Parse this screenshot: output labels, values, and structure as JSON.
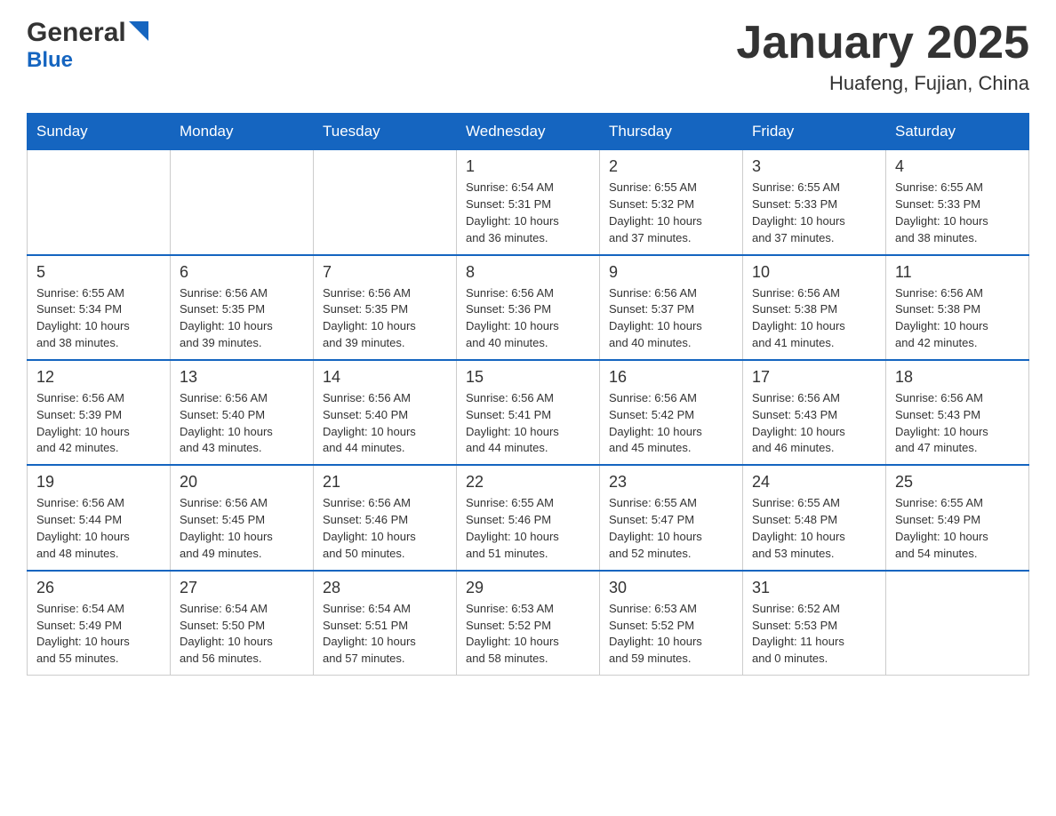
{
  "header": {
    "title": "January 2025",
    "subtitle": "Huafeng, Fujian, China",
    "logo_general": "General",
    "logo_blue": "Blue"
  },
  "calendar": {
    "days_of_week": [
      "Sunday",
      "Monday",
      "Tuesday",
      "Wednesday",
      "Thursday",
      "Friday",
      "Saturday"
    ],
    "weeks": [
      [
        {
          "day": "",
          "info": ""
        },
        {
          "day": "",
          "info": ""
        },
        {
          "day": "",
          "info": ""
        },
        {
          "day": "1",
          "info": "Sunrise: 6:54 AM\nSunset: 5:31 PM\nDaylight: 10 hours\nand 36 minutes."
        },
        {
          "day": "2",
          "info": "Sunrise: 6:55 AM\nSunset: 5:32 PM\nDaylight: 10 hours\nand 37 minutes."
        },
        {
          "day": "3",
          "info": "Sunrise: 6:55 AM\nSunset: 5:33 PM\nDaylight: 10 hours\nand 37 minutes."
        },
        {
          "day": "4",
          "info": "Sunrise: 6:55 AM\nSunset: 5:33 PM\nDaylight: 10 hours\nand 38 minutes."
        }
      ],
      [
        {
          "day": "5",
          "info": "Sunrise: 6:55 AM\nSunset: 5:34 PM\nDaylight: 10 hours\nand 38 minutes."
        },
        {
          "day": "6",
          "info": "Sunrise: 6:56 AM\nSunset: 5:35 PM\nDaylight: 10 hours\nand 39 minutes."
        },
        {
          "day": "7",
          "info": "Sunrise: 6:56 AM\nSunset: 5:35 PM\nDaylight: 10 hours\nand 39 minutes."
        },
        {
          "day": "8",
          "info": "Sunrise: 6:56 AM\nSunset: 5:36 PM\nDaylight: 10 hours\nand 40 minutes."
        },
        {
          "day": "9",
          "info": "Sunrise: 6:56 AM\nSunset: 5:37 PM\nDaylight: 10 hours\nand 40 minutes."
        },
        {
          "day": "10",
          "info": "Sunrise: 6:56 AM\nSunset: 5:38 PM\nDaylight: 10 hours\nand 41 minutes."
        },
        {
          "day": "11",
          "info": "Sunrise: 6:56 AM\nSunset: 5:38 PM\nDaylight: 10 hours\nand 42 minutes."
        }
      ],
      [
        {
          "day": "12",
          "info": "Sunrise: 6:56 AM\nSunset: 5:39 PM\nDaylight: 10 hours\nand 42 minutes."
        },
        {
          "day": "13",
          "info": "Sunrise: 6:56 AM\nSunset: 5:40 PM\nDaylight: 10 hours\nand 43 minutes."
        },
        {
          "day": "14",
          "info": "Sunrise: 6:56 AM\nSunset: 5:40 PM\nDaylight: 10 hours\nand 44 minutes."
        },
        {
          "day": "15",
          "info": "Sunrise: 6:56 AM\nSunset: 5:41 PM\nDaylight: 10 hours\nand 44 minutes."
        },
        {
          "day": "16",
          "info": "Sunrise: 6:56 AM\nSunset: 5:42 PM\nDaylight: 10 hours\nand 45 minutes."
        },
        {
          "day": "17",
          "info": "Sunrise: 6:56 AM\nSunset: 5:43 PM\nDaylight: 10 hours\nand 46 minutes."
        },
        {
          "day": "18",
          "info": "Sunrise: 6:56 AM\nSunset: 5:43 PM\nDaylight: 10 hours\nand 47 minutes."
        }
      ],
      [
        {
          "day": "19",
          "info": "Sunrise: 6:56 AM\nSunset: 5:44 PM\nDaylight: 10 hours\nand 48 minutes."
        },
        {
          "day": "20",
          "info": "Sunrise: 6:56 AM\nSunset: 5:45 PM\nDaylight: 10 hours\nand 49 minutes."
        },
        {
          "day": "21",
          "info": "Sunrise: 6:56 AM\nSunset: 5:46 PM\nDaylight: 10 hours\nand 50 minutes."
        },
        {
          "day": "22",
          "info": "Sunrise: 6:55 AM\nSunset: 5:46 PM\nDaylight: 10 hours\nand 51 minutes."
        },
        {
          "day": "23",
          "info": "Sunrise: 6:55 AM\nSunset: 5:47 PM\nDaylight: 10 hours\nand 52 minutes."
        },
        {
          "day": "24",
          "info": "Sunrise: 6:55 AM\nSunset: 5:48 PM\nDaylight: 10 hours\nand 53 minutes."
        },
        {
          "day": "25",
          "info": "Sunrise: 6:55 AM\nSunset: 5:49 PM\nDaylight: 10 hours\nand 54 minutes."
        }
      ],
      [
        {
          "day": "26",
          "info": "Sunrise: 6:54 AM\nSunset: 5:49 PM\nDaylight: 10 hours\nand 55 minutes."
        },
        {
          "day": "27",
          "info": "Sunrise: 6:54 AM\nSunset: 5:50 PM\nDaylight: 10 hours\nand 56 minutes."
        },
        {
          "day": "28",
          "info": "Sunrise: 6:54 AM\nSunset: 5:51 PM\nDaylight: 10 hours\nand 57 minutes."
        },
        {
          "day": "29",
          "info": "Sunrise: 6:53 AM\nSunset: 5:52 PM\nDaylight: 10 hours\nand 58 minutes."
        },
        {
          "day": "30",
          "info": "Sunrise: 6:53 AM\nSunset: 5:52 PM\nDaylight: 10 hours\nand 59 minutes."
        },
        {
          "day": "31",
          "info": "Sunrise: 6:52 AM\nSunset: 5:53 PM\nDaylight: 11 hours\nand 0 minutes."
        },
        {
          "day": "",
          "info": ""
        }
      ]
    ]
  }
}
